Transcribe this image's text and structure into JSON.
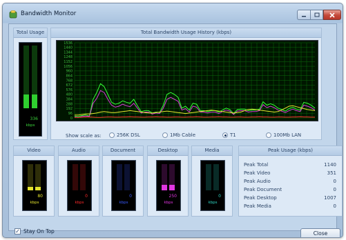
{
  "window": {
    "title": "Bandwidth Monitor",
    "accent": "#c2d6eb"
  },
  "total_usage": {
    "title": "Total Usage",
    "value": "336",
    "unit": "kbps",
    "color": "#3bd43b",
    "level": 0.22
  },
  "history": {
    "title": "Total Bandwidth Usage History (kbps)",
    "y_ticks": [
      "1536",
      "1440",
      "1344",
      "1248",
      "1152",
      "1056",
      "960",
      "864",
      "768",
      "672",
      "576",
      "480",
      "384",
      "288",
      "192",
      "96",
      "0"
    ],
    "scale_label": "Show scale as:",
    "scale_options": [
      {
        "label": "256K DSL",
        "selected": false
      },
      {
        "label": "1Mb Cable",
        "selected": false
      },
      {
        "label": "T1",
        "selected": true
      },
      {
        "label": "100Mb LAN",
        "selected": false
      }
    ]
  },
  "chart_data": {
    "type": "line",
    "ylim": [
      0,
      1536
    ],
    "series": [
      {
        "color": "#35ff35",
        "values": [
          40,
          30,
          50,
          60,
          40,
          380,
          520,
          700,
          640,
          480,
          320,
          280,
          300,
          350,
          320,
          300,
          380,
          250,
          130,
          150,
          150,
          100,
          120,
          110,
          260,
          480,
          520,
          480,
          420,
          200,
          240,
          160,
          300,
          280,
          150,
          150,
          130,
          150,
          150,
          120,
          160,
          200,
          170,
          90,
          170,
          180,
          180,
          150,
          160,
          160,
          180,
          330,
          260,
          290,
          260,
          200,
          170,
          140,
          190,
          220,
          180,
          160,
          320,
          300,
          260,
          200
        ]
      },
      {
        "color": "#d63bd6",
        "values": [
          20,
          10,
          30,
          40,
          30,
          300,
          400,
          560,
          520,
          380,
          260,
          220,
          240,
          280,
          250,
          230,
          300,
          200,
          100,
          120,
          120,
          80,
          100,
          90,
          200,
          380,
          420,
          380,
          340,
          160,
          190,
          120,
          240,
          220,
          120,
          120,
          100,
          120,
          120,
          90,
          130,
          160,
          140,
          70,
          140,
          150,
          150,
          120,
          130,
          130,
          150,
          270,
          210,
          240,
          210,
          160,
          140,
          110,
          150,
          180,
          150,
          130,
          260,
          240,
          210,
          160
        ]
      },
      {
        "color": "#e8e830",
        "values": [
          60,
          60,
          70,
          80,
          80,
          90,
          100,
          120,
          130,
          120,
          110,
          110,
          120,
          130,
          140,
          150,
          140,
          130,
          120,
          110,
          100,
          100,
          110,
          120,
          130,
          140,
          130,
          120,
          110,
          100,
          90,
          100,
          110,
          120,
          130,
          140,
          150,
          160,
          150,
          140,
          130,
          120,
          110,
          100,
          110,
          120,
          150,
          170,
          180,
          170,
          160,
          150,
          140,
          130,
          120,
          130,
          160,
          200,
          240,
          250,
          230,
          210,
          190,
          170,
          160,
          150
        ]
      },
      {
        "color": "#ff3030",
        "values": [
          10,
          10,
          15,
          15,
          20,
          15,
          10,
          10,
          15,
          20,
          20,
          15,
          15,
          20,
          20,
          25,
          20,
          20,
          15,
          15,
          20,
          20,
          25,
          20,
          20,
          15,
          15,
          20,
          20,
          15,
          15,
          20,
          20,
          25,
          20,
          15,
          15,
          20,
          20,
          25,
          20,
          20,
          15,
          15,
          20,
          20,
          15,
          15,
          20,
          20,
          25,
          20,
          20,
          15,
          15,
          20,
          20,
          15,
          15,
          20,
          20,
          25,
          20,
          20,
          15,
          15
        ]
      }
    ]
  },
  "mini_meters": [
    {
      "name": "video",
      "title": "Video",
      "value": "80",
      "unit": "kbps",
      "color": "#e5e52e",
      "level": 0.12
    },
    {
      "name": "audio",
      "title": "Audio",
      "value": "0",
      "unit": "kbps",
      "color": "#ff2a2a",
      "level": 0
    },
    {
      "name": "document",
      "title": "Document",
      "value": "0",
      "unit": "kbps",
      "color": "#3a5bff",
      "level": 0
    },
    {
      "name": "desktop",
      "title": "Desktop",
      "value": "250",
      "unit": "kbps",
      "color": "#e036e0",
      "level": 0.22
    },
    {
      "name": "media",
      "title": "Media",
      "value": "0",
      "unit": "kbps",
      "color": "#2fd6c4",
      "level": 0
    }
  ],
  "peak": {
    "title": "Peak Usage (kbps)",
    "rows": [
      {
        "label": "Peak Total",
        "value": "1140"
      },
      {
        "label": "Peak Video",
        "value": "351"
      },
      {
        "label": "Peak Audio",
        "value": "0"
      },
      {
        "label": "Peak Document",
        "value": "0"
      },
      {
        "label": "Peak Desktop",
        "value": "1007"
      },
      {
        "label": "Peak Media",
        "value": "0"
      }
    ]
  },
  "footer": {
    "stay_on_top": "Stay On Top",
    "stay_on_top_checked": true,
    "close": "Close"
  }
}
